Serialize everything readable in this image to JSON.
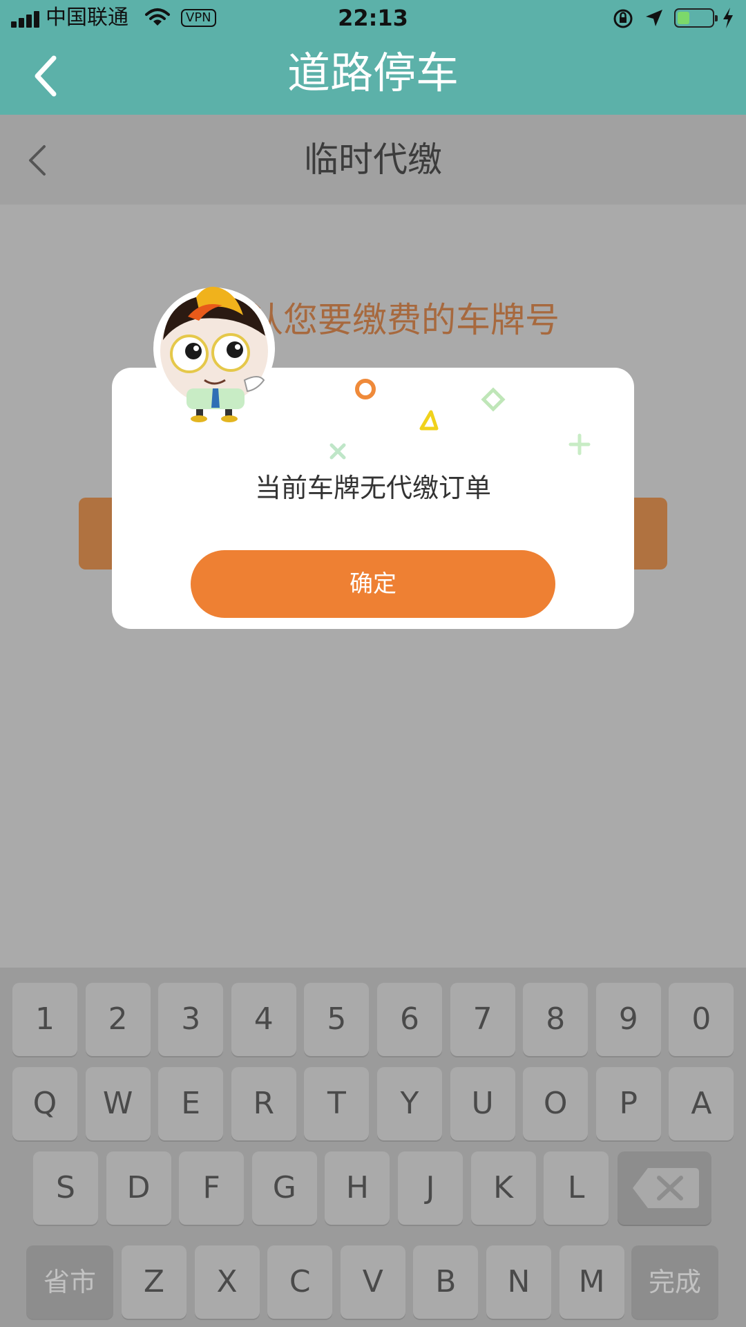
{
  "status_bar": {
    "carrier": "中国联通",
    "vpn": "VPN",
    "time": "22:13",
    "battery_level": 0.35
  },
  "app_header": {
    "title": "道路停车",
    "back_icon": "chevron-left-icon"
  },
  "page": {
    "title": "临时代缴",
    "back_icon": "chevron-left-icon",
    "prompt": "认您要缴费的车牌号"
  },
  "dialog": {
    "message": "当前车牌无代缴订单",
    "confirm_label": "确定",
    "accent_color": "#ee8033"
  },
  "keyboard": {
    "row1": [
      "1",
      "2",
      "3",
      "4",
      "5",
      "6",
      "7",
      "8",
      "9",
      "0"
    ],
    "row2": [
      "Q",
      "W",
      "E",
      "R",
      "T",
      "Y",
      "U",
      "O",
      "P",
      "A"
    ],
    "row3": [
      "S",
      "D",
      "F",
      "G",
      "H",
      "J",
      "K",
      "L"
    ],
    "row4": [
      "Z",
      "X",
      "C",
      "V",
      "B",
      "N",
      "M"
    ],
    "province_label": "省市",
    "done_label": "完成",
    "delete_icon": "backspace-icon"
  },
  "colors": {
    "header": "#5cb1a9",
    "overlay_bg": "#aaaaaa",
    "prompt": "#a7693e"
  }
}
